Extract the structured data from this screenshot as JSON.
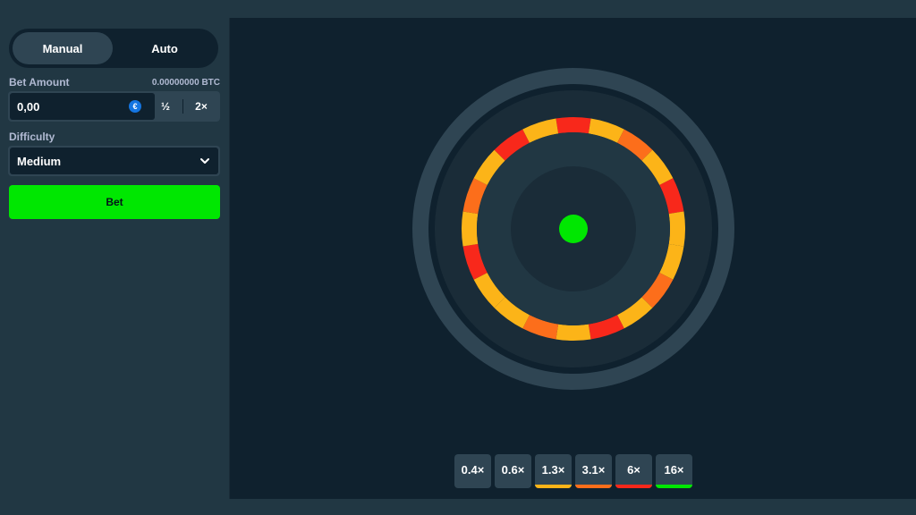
{
  "sidebar": {
    "modes": [
      {
        "label": "Manual",
        "active": true
      },
      {
        "label": "Auto",
        "active": false
      }
    ],
    "bet_amount": {
      "label": "Bet Amount",
      "balance": "0.00000000 BTC",
      "value": "0,00",
      "currency_icon": "coin-icon",
      "currency_glyph": "€",
      "half_label": "½",
      "double_label": "2×"
    },
    "difficulty": {
      "label": "Difficulty",
      "value": "Medium"
    },
    "bet_button_label": "Bet"
  },
  "wheel": {
    "segment_colors": [
      "#f8281b",
      "#fcb418",
      "#fc6e1b",
      "#fcb418",
      "#f8281b",
      "#fcb418",
      "#fcb418",
      "#fc6e1b",
      "#fcb418",
      "#f8281b",
      "#fcb418",
      "#fc6e1b",
      "#fcb418",
      "#fcb418",
      "#f8281b",
      "#fcb418",
      "#fc6e1b",
      "#fcb418",
      "#f8281b",
      "#fcb418"
    ],
    "pointer_color": "#00e701"
  },
  "multipliers": [
    {
      "label": "0.4×",
      "color": ""
    },
    {
      "label": "0.6×",
      "color": ""
    },
    {
      "label": "1.3×",
      "color": "#fcb418"
    },
    {
      "label": "3.1×",
      "color": "#fc6e1b"
    },
    {
      "label": "6×",
      "color": "#f8281b"
    },
    {
      "label": "16×",
      "color": "#00e701"
    }
  ],
  "colors": {
    "accent_green": "#00e701",
    "panel": "#213743",
    "background": "#0f212e",
    "control": "#2f4553"
  }
}
